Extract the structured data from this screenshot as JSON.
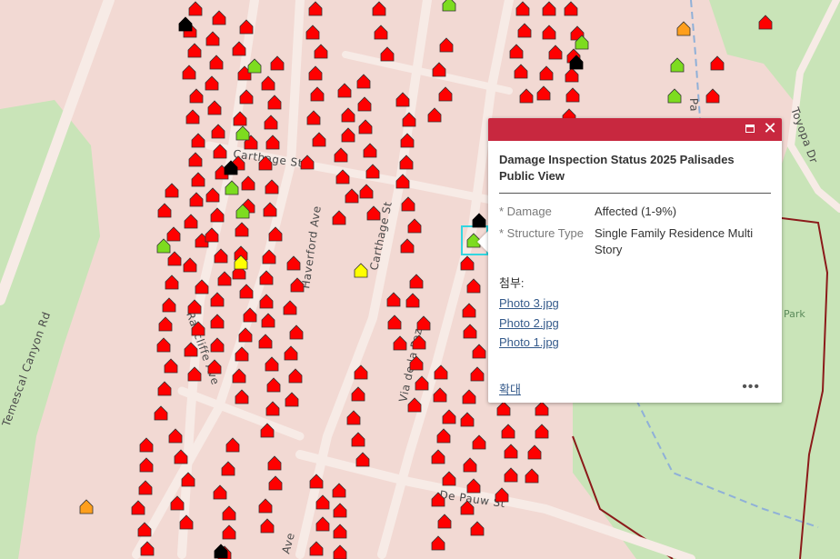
{
  "map": {
    "roads": [
      "Carthage St",
      "Haverford Ave",
      "Carthage St",
      "Radcliffe Ave",
      "Via de la Paz",
      "De Pauw St",
      "Temescal Canyon Rd",
      "Toyopa Dr",
      "Pa",
      "Ave"
    ],
    "park_label": "Park",
    "status_colors": {
      "destroyed": "#ff0000",
      "affected": "#7ddc1f",
      "minor": "#ffff00",
      "major": "#ff9f1c",
      "inaccessible": "#000000"
    }
  },
  "popup": {
    "title": "Damage Inspection Status 2025 Palisades Public View",
    "fields": [
      {
        "label": "* Damage",
        "value": "Affected (1-9%)"
      },
      {
        "label": "* Structure Type",
        "value": "Single Family Residence Multi Story"
      }
    ],
    "attachments_label": "첨부:",
    "attachments": [
      "Photo 3.jpg",
      "Photo 2.jpg",
      "Photo 1.jpg"
    ],
    "zoom_label": "확대",
    "more_label": "•••",
    "close_label": "✕"
  }
}
